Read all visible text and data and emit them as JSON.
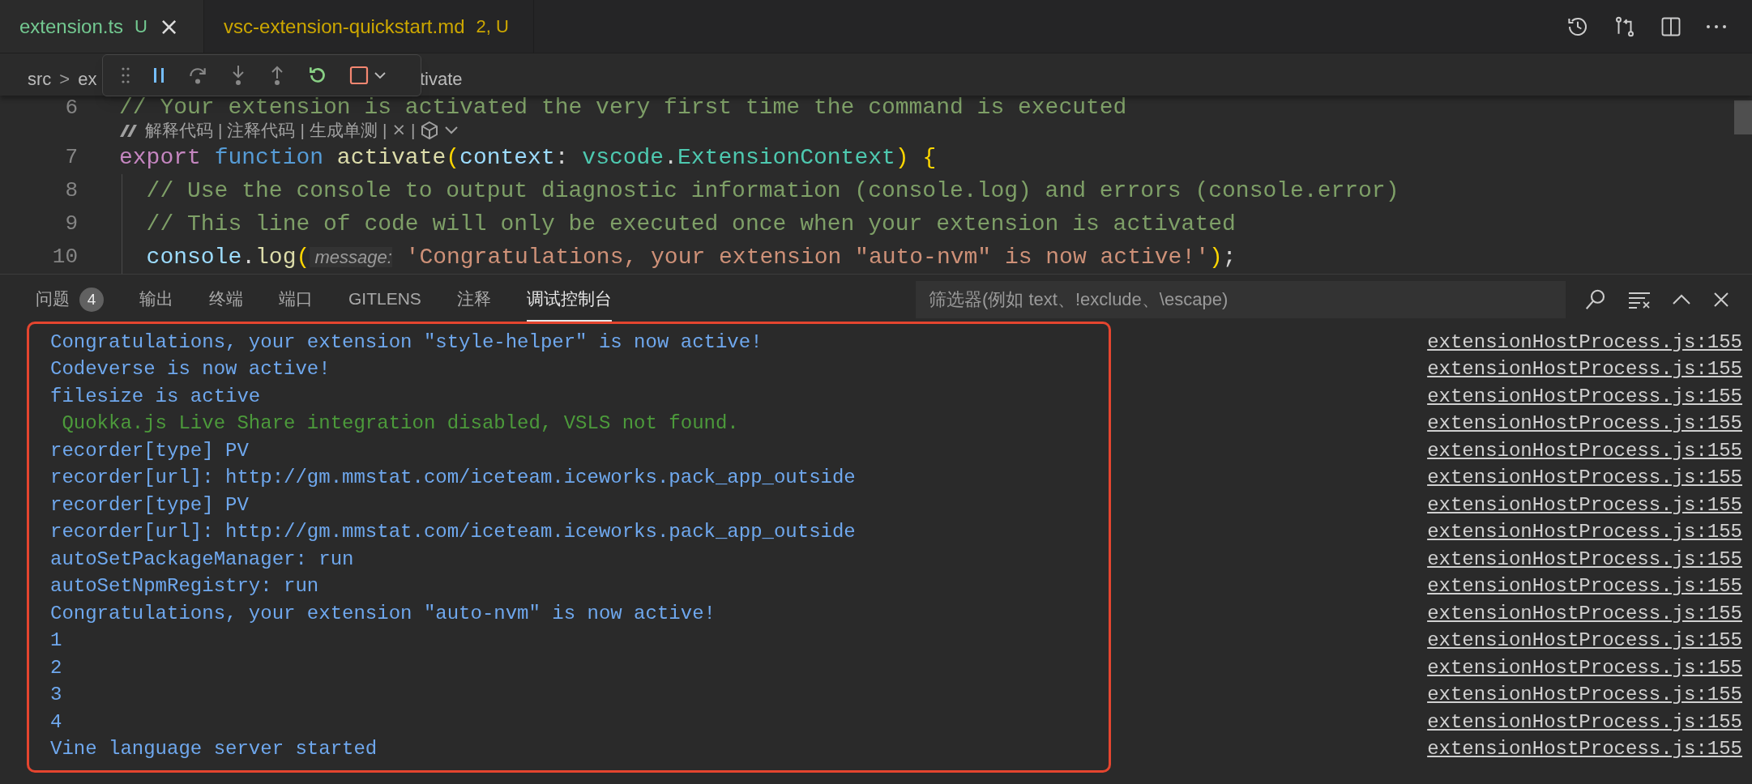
{
  "editor_tabs": [
    {
      "label": "extension.ts",
      "badge": "U",
      "selected": true,
      "close": "×",
      "kind": "untracked"
    },
    {
      "label": "vsc-extension-quickstart.md",
      "badge": "2, U",
      "selected": false,
      "kind": "warning"
    }
  ],
  "breadcrumb": {
    "items": [
      "src",
      "ex"
    ],
    "separator": ">",
    "tail": "tivate"
  },
  "codelens": {
    "actions": [
      "解释代码",
      "注释代码",
      "生成单测"
    ],
    "separator": "|",
    "close": "×"
  },
  "code_lines": [
    {
      "number": "6",
      "tokens": [
        {
          "text": "// Your extension is activated the very first time the command is executed",
          "kind": "comment"
        }
      ]
    },
    {
      "number": "7",
      "tokens": [
        {
          "text": "export ",
          "kind": "keyword"
        },
        {
          "text": "function ",
          "kind": "storage"
        },
        {
          "text": "activate",
          "kind": "function"
        },
        {
          "text": "(",
          "kind": "bracket"
        },
        {
          "text": "context",
          "kind": "param"
        },
        {
          "text": ": ",
          "kind": "plain"
        },
        {
          "text": "vscode",
          "kind": "type"
        },
        {
          "text": ".",
          "kind": "plain"
        },
        {
          "text": "ExtensionContext",
          "kind": "type"
        },
        {
          "text": ") ",
          "kind": "bracket"
        },
        {
          "text": "{",
          "kind": "bracket"
        }
      ]
    },
    {
      "number": "8",
      "tokens": [
        {
          "text": "  // Use the console to output diagnostic information (console.log) and errors (console.error)",
          "kind": "comment"
        }
      ]
    },
    {
      "number": "9",
      "tokens": [
        {
          "text": "  // This line of code will only be executed once when your extension is activated",
          "kind": "comment"
        }
      ]
    },
    {
      "number": "10",
      "tokens": [
        {
          "text": "  console",
          "kind": "param"
        },
        {
          "text": ".",
          "kind": "plain"
        },
        {
          "text": "log",
          "kind": "function"
        },
        {
          "text": "(",
          "kind": "bracket"
        },
        {
          "text": " message:",
          "kind": "hint"
        },
        {
          "text": " 'Congratulations, your extension \"auto-nvm\" is now active!'",
          "kind": "string"
        },
        {
          "text": ")",
          "kind": "bracket"
        },
        {
          "text": ";",
          "kind": "plain"
        }
      ]
    }
  ],
  "panel_tabs": [
    {
      "label": "问题",
      "badge": "4",
      "selected": false
    },
    {
      "label": "输出",
      "selected": false
    },
    {
      "label": "终端",
      "selected": false
    },
    {
      "label": "端口",
      "selected": false
    },
    {
      "label": "GITLENS",
      "selected": false
    },
    {
      "label": "注释",
      "selected": false
    },
    {
      "label": "调试控制台",
      "selected": true
    }
  ],
  "filter": {
    "placeholder": "筛选器(例如 text、!exclude、\\escape)"
  },
  "console_lines": [
    {
      "message": "Congratulations, your extension \"style-helper\" is now active!",
      "source": "extensionHostProcess.js:155",
      "kind": "log"
    },
    {
      "message": "Codeverse is now active!",
      "source": "extensionHostProcess.js:155",
      "kind": "log"
    },
    {
      "message": "filesize is active",
      "source": "extensionHostProcess.js:155",
      "kind": "log"
    },
    {
      "message": " Quokka.js Live Share integration disabled, VSLS not found.",
      "source": "extensionHostProcess.js:155",
      "kind": "styled"
    },
    {
      "message": "recorder[type] PV",
      "source": "extensionHostProcess.js:155",
      "kind": "log"
    },
    {
      "message": "recorder[url]: http://gm.mmstat.com/iceteam.iceworks.pack_app_outside",
      "source": "extensionHostProcess.js:155",
      "kind": "log"
    },
    {
      "message": "recorder[type] PV",
      "source": "extensionHostProcess.js:155",
      "kind": "log"
    },
    {
      "message": "recorder[url]: http://gm.mmstat.com/iceteam.iceworks.pack_app_outside",
      "source": "extensionHostProcess.js:155",
      "kind": "log"
    },
    {
      "message": "autoSetPackageManager: run",
      "source": "extensionHostProcess.js:155",
      "kind": "log"
    },
    {
      "message": "autoSetNpmRegistry: run",
      "source": "extensionHostProcess.js:155",
      "kind": "log"
    },
    {
      "message": "Congratulations, your extension \"auto-nvm\" is now active!",
      "source": "extensionHostProcess.js:155",
      "kind": "log"
    },
    {
      "message": "1",
      "source": "extensionHostProcess.js:155",
      "kind": "log"
    },
    {
      "message": "2",
      "source": "extensionHostProcess.js:155",
      "kind": "log"
    },
    {
      "message": "3",
      "source": "extensionHostProcess.js:155",
      "kind": "log"
    },
    {
      "message": "4",
      "source": "extensionHostProcess.js:155",
      "kind": "log"
    },
    {
      "message": "Vine language server started",
      "source": "extensionHostProcess.js:155",
      "kind": "log"
    }
  ]
}
